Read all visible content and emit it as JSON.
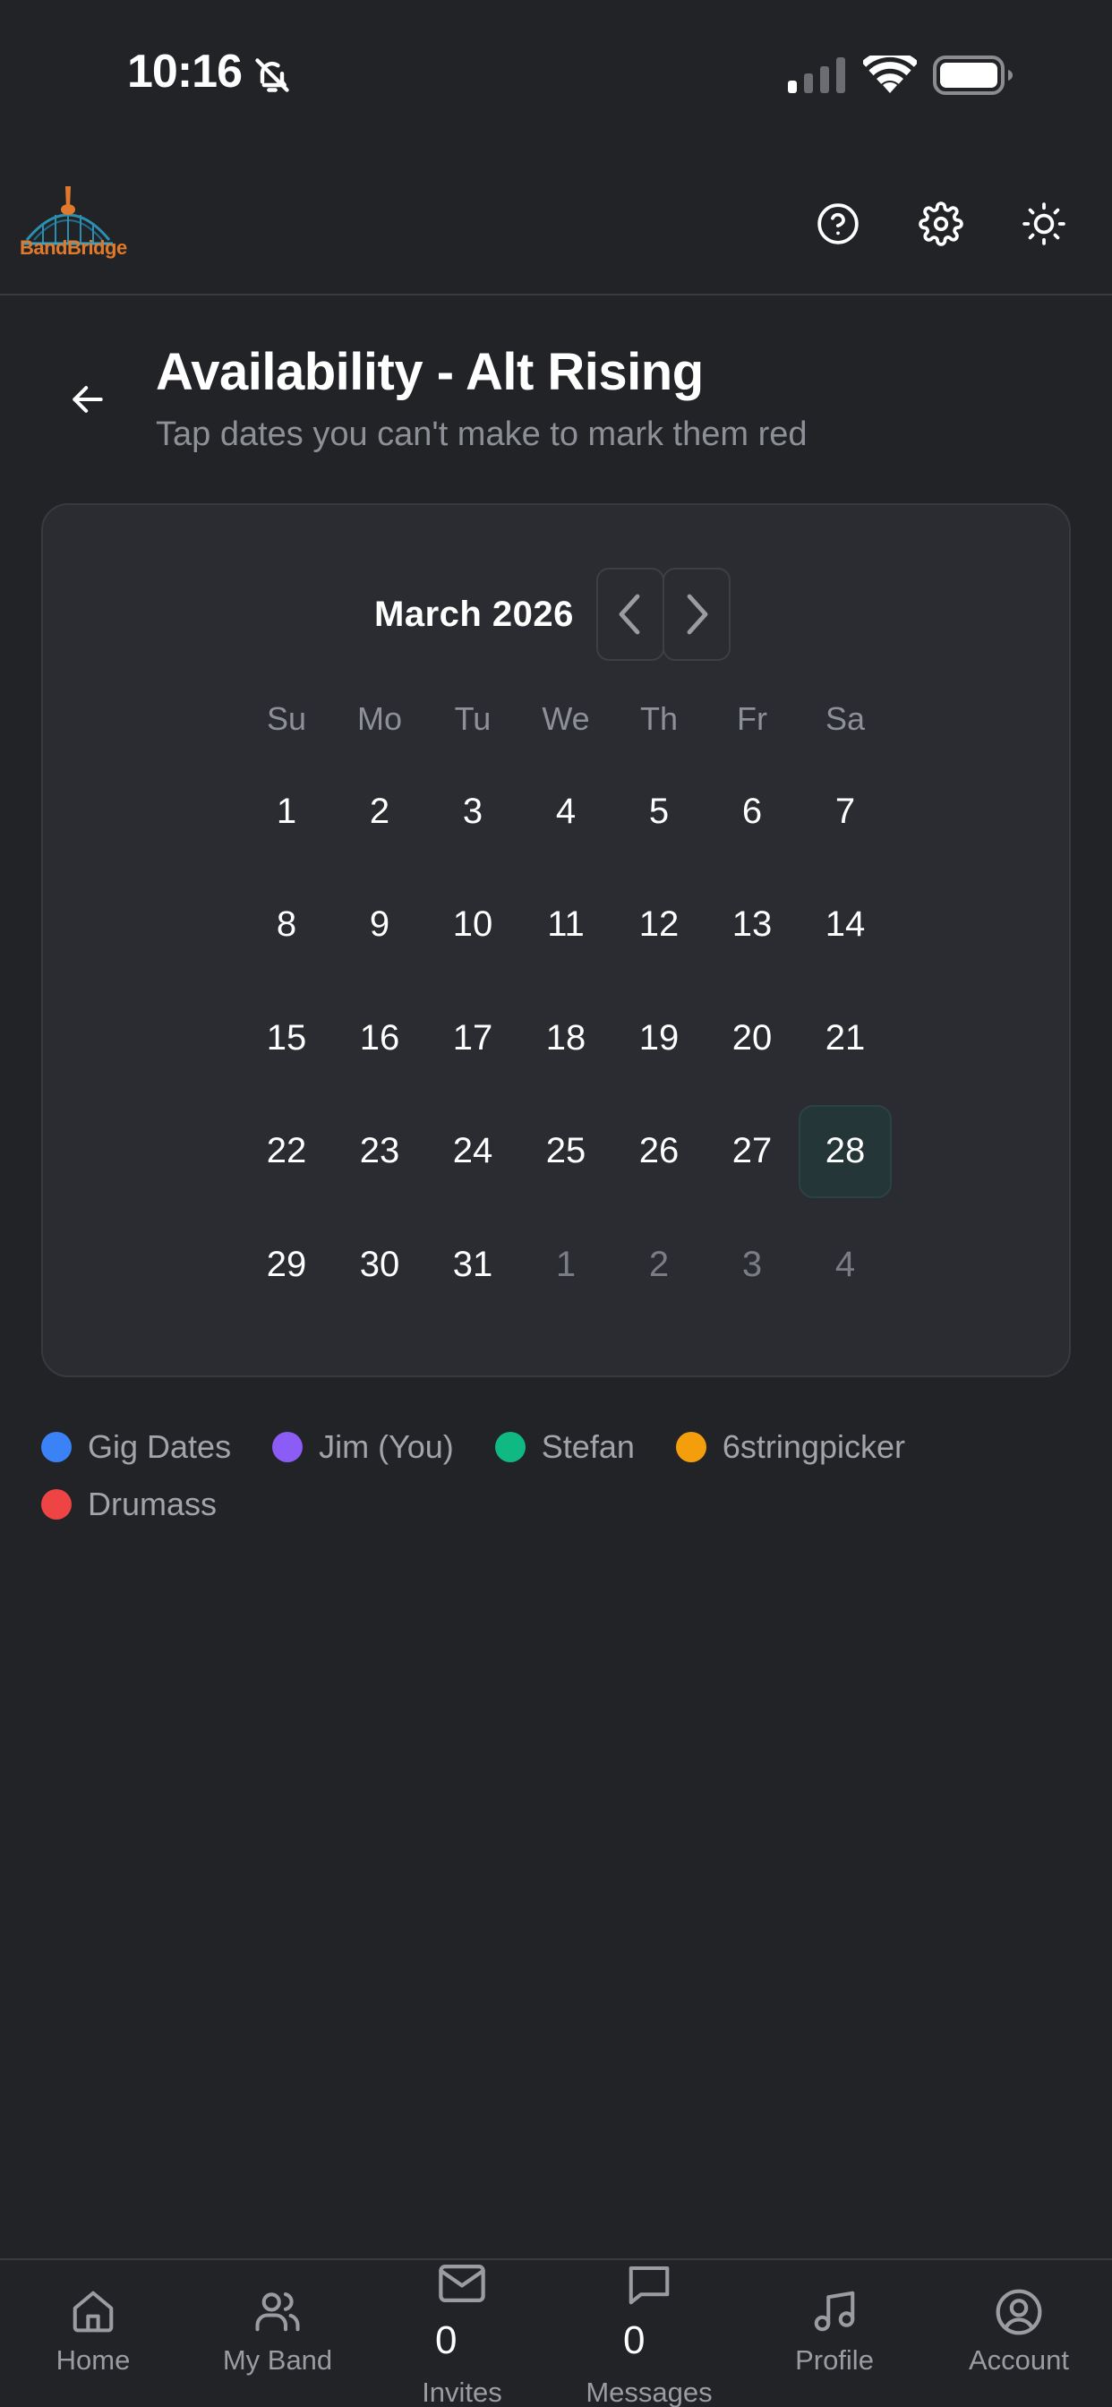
{
  "status_bar": {
    "time": "10:16",
    "icons": [
      "bell-slash-icon",
      "signal-icon",
      "wifi-icon",
      "battery-icon"
    ]
  },
  "header": {
    "logo_text": "BandBridge",
    "icons": [
      "help-icon",
      "gear-icon",
      "sun-icon"
    ]
  },
  "page": {
    "title": "Availability - Alt Rising",
    "subtitle": "Tap dates you can't make to mark them red"
  },
  "calendar": {
    "month_label": "March 2026",
    "weekdays": [
      "Su",
      "Mo",
      "Tu",
      "We",
      "Th",
      "Fr",
      "Sa"
    ],
    "weeks": [
      [
        {
          "d": "1"
        },
        {
          "d": "2"
        },
        {
          "d": "3"
        },
        {
          "d": "4"
        },
        {
          "d": "5"
        },
        {
          "d": "6"
        },
        {
          "d": "7"
        }
      ],
      [
        {
          "d": "8"
        },
        {
          "d": "9"
        },
        {
          "d": "10"
        },
        {
          "d": "11"
        },
        {
          "d": "12"
        },
        {
          "d": "13"
        },
        {
          "d": "14"
        }
      ],
      [
        {
          "d": "15"
        },
        {
          "d": "16"
        },
        {
          "d": "17"
        },
        {
          "d": "18"
        },
        {
          "d": "19"
        },
        {
          "d": "20"
        },
        {
          "d": "21"
        }
      ],
      [
        {
          "d": "22"
        },
        {
          "d": "23"
        },
        {
          "d": "24"
        },
        {
          "d": "25"
        },
        {
          "d": "26"
        },
        {
          "d": "27"
        },
        {
          "d": "28",
          "today": true
        }
      ],
      [
        {
          "d": "29"
        },
        {
          "d": "30"
        },
        {
          "d": "31"
        },
        {
          "d": "1",
          "outside": true
        },
        {
          "d": "2",
          "outside": true
        },
        {
          "d": "3",
          "outside": true
        },
        {
          "d": "4",
          "outside": true
        }
      ]
    ],
    "today_highlight_color": "#243638"
  },
  "legend": [
    {
      "label": "Gig Dates",
      "color": "#3b82f6"
    },
    {
      "label": "Jim (You)",
      "color": "#8b5cf6"
    },
    {
      "label": "Stefan",
      "color": "#10b981"
    },
    {
      "label": "6stringpicker",
      "color": "#f59e0b"
    },
    {
      "label": "Drumass",
      "color": "#ef4444"
    }
  ],
  "bottom_nav": {
    "home": {
      "label": "Home",
      "icon": "home-icon"
    },
    "my_band": {
      "label": "My Band",
      "icon": "users-icon"
    },
    "invites": {
      "label": "Invites",
      "count": "0",
      "icon": "mail-icon"
    },
    "messages": {
      "label": "Messages",
      "count": "0",
      "icon": "message-icon"
    },
    "profile": {
      "label": "Profile",
      "icon": "music-note-icon"
    },
    "account": {
      "label": "Account",
      "icon": "user-circle-icon"
    }
  }
}
